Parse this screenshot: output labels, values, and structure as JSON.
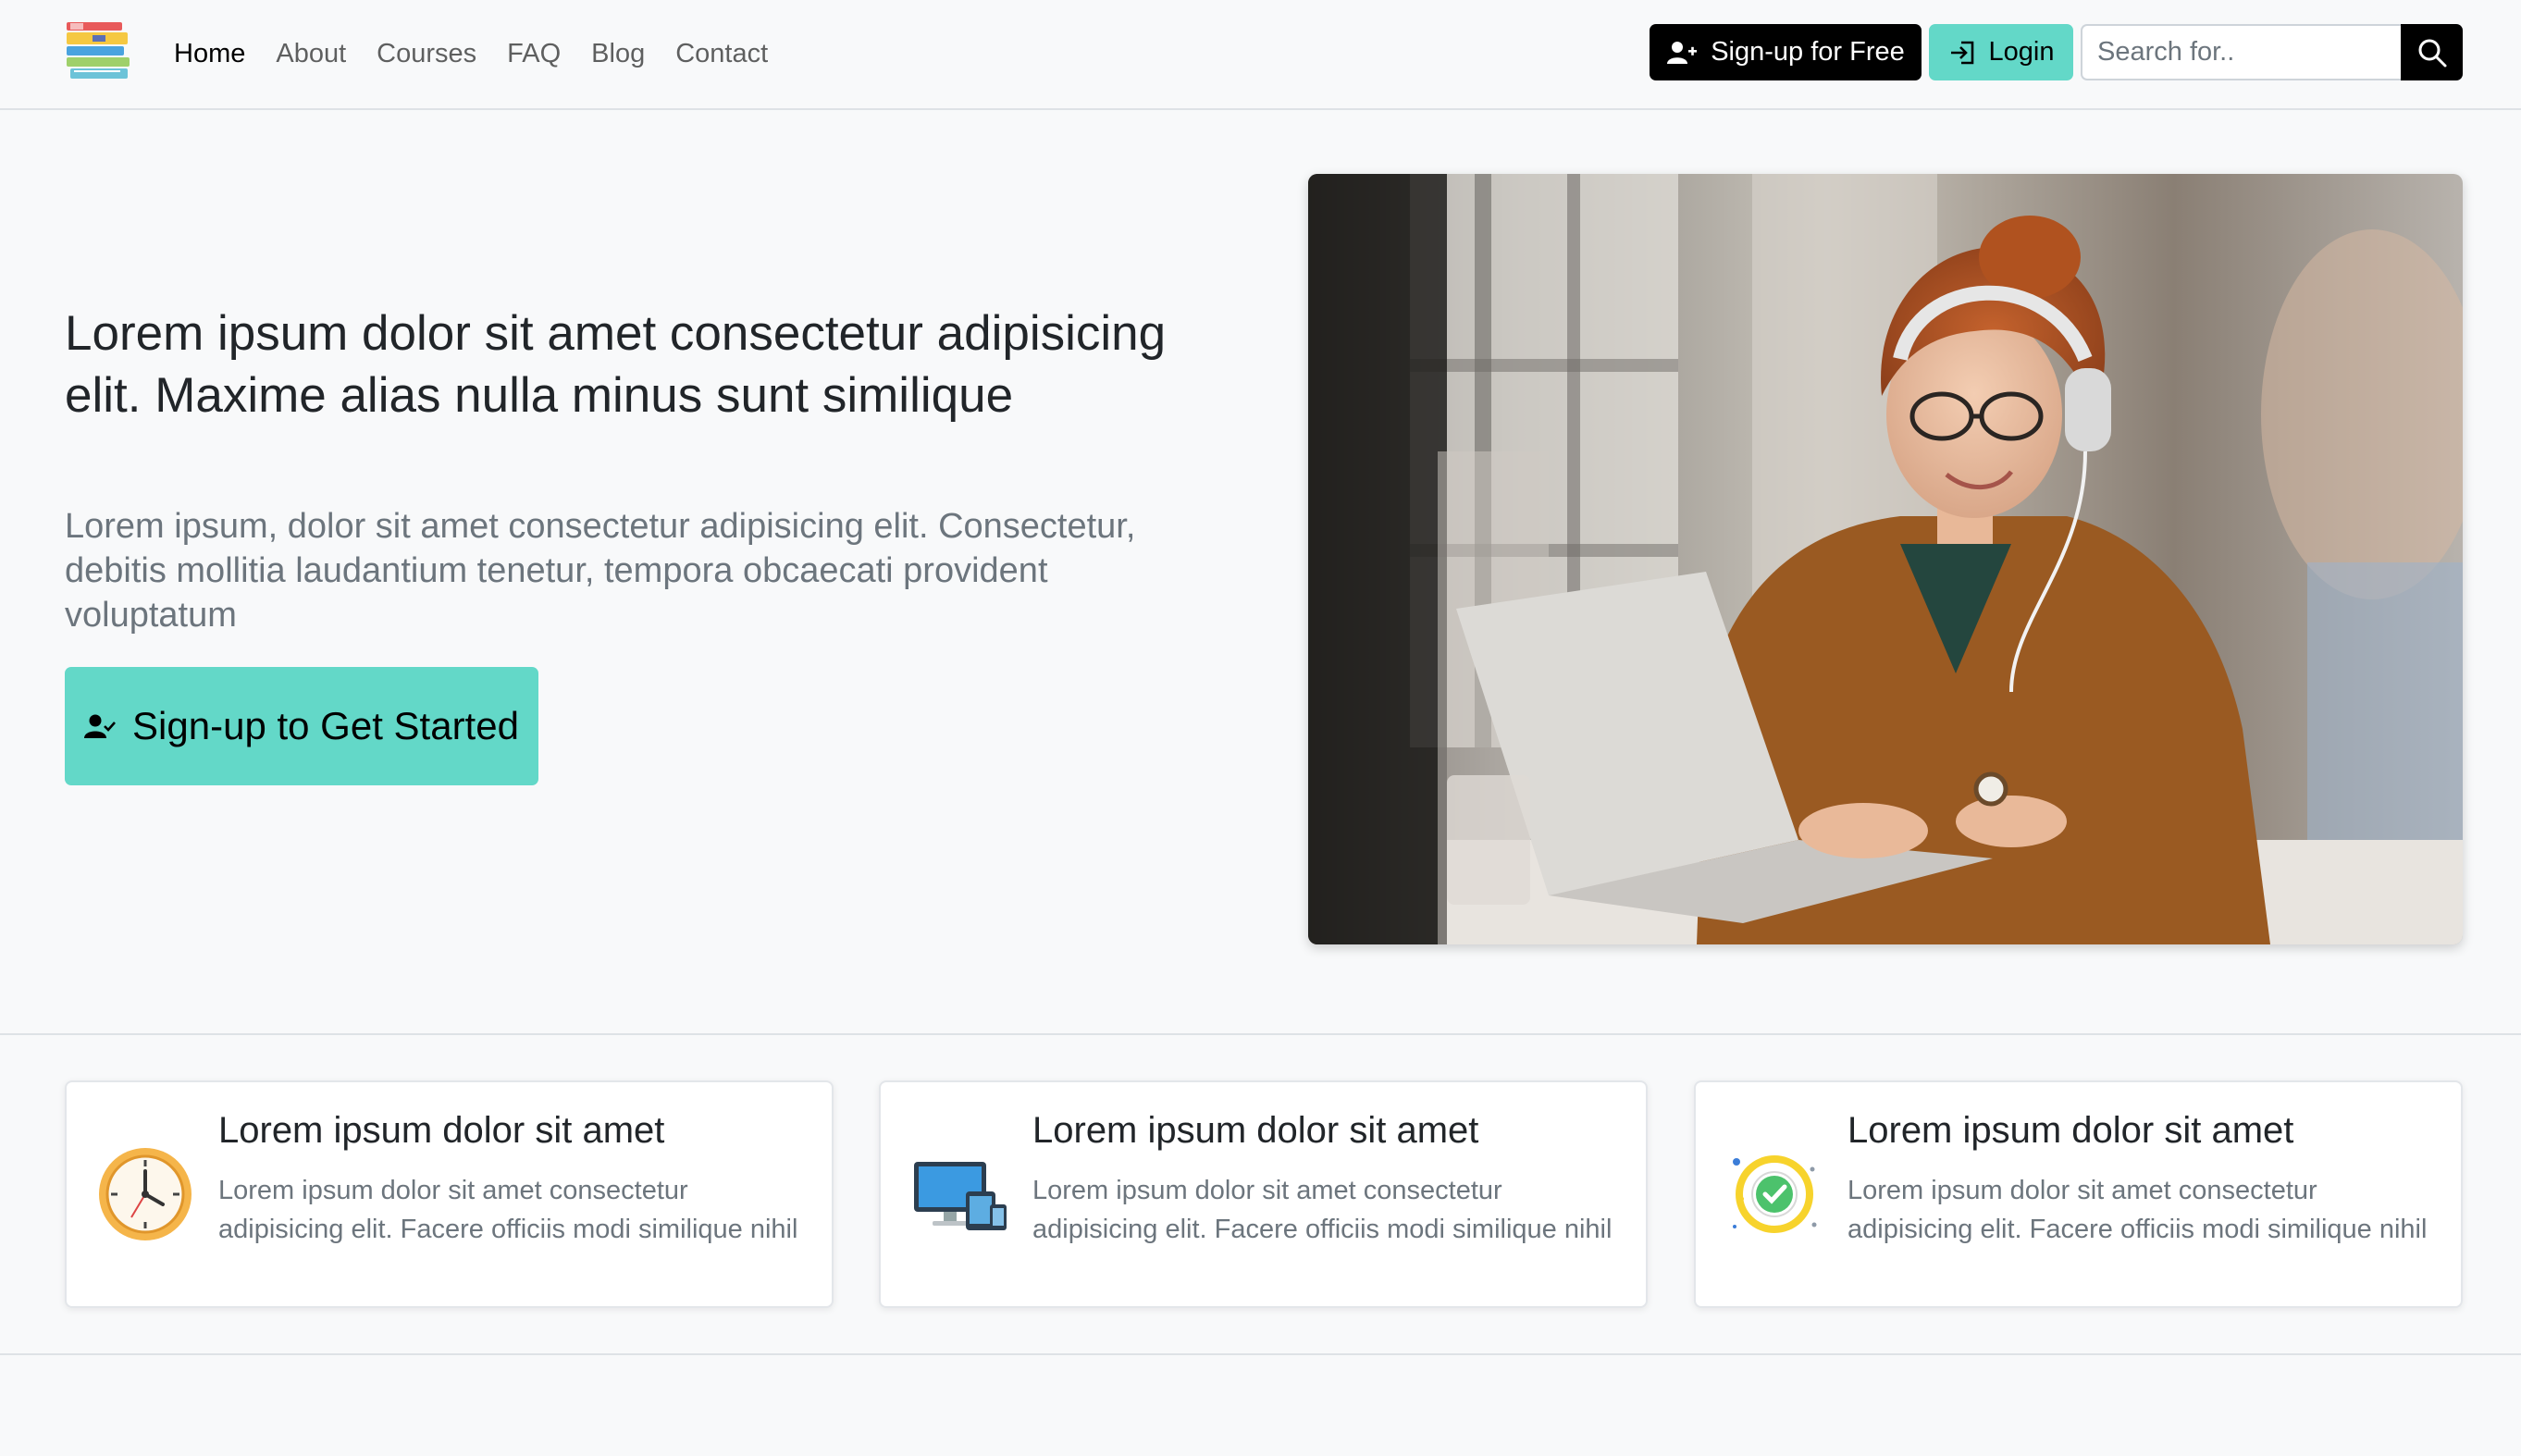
{
  "nav": {
    "links": [
      "Home",
      "About",
      "Courses",
      "FAQ",
      "Blog",
      "Contact"
    ],
    "signup_label": "Sign-up for Free",
    "login_label": "Login",
    "search_placeholder": "Search for.."
  },
  "hero": {
    "title": "Lorem ipsum dolor sit amet consectetur adipisicing elit. Maxime alias nulla minus sunt similique",
    "subtitle": "Lorem ipsum, dolor sit amet consectetur adipisicing elit. Consectetur, debitis mollitia laudantium tenetur, tempora obcaecati provident voluptatum",
    "cta_label": "Sign-up to Get Started"
  },
  "features": [
    {
      "icon": "clock-icon",
      "title": "Lorem ipsum dolor sit amet",
      "text": "Lorem ipsum dolor sit amet consectetur adipisicing elit. Facere officiis modi similique nihil"
    },
    {
      "icon": "devices-icon",
      "title": "Lorem ipsum dolor sit amet",
      "text": "Lorem ipsum dolor sit amet consectetur adipisicing elit. Facere officiis modi similique nihil"
    },
    {
      "icon": "check-badge-icon",
      "title": "Lorem ipsum dolor sit amet",
      "text": "Lorem ipsum dolor sit amet consectetur adipisicing elit. Facere officiis modi similique nihil"
    }
  ],
  "colors": {
    "accent": "#63d8c8",
    "dark": "#000000",
    "background": "#f8f9fa"
  }
}
